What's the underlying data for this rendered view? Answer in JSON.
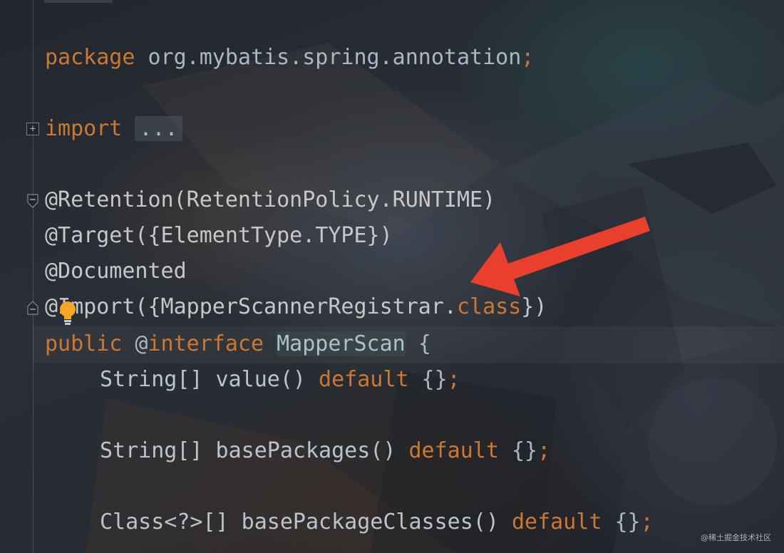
{
  "editor": {
    "lines": {
      "package": {
        "kw": "package",
        "rest": " org.mybatis.spring.annotation",
        "semi": ";"
      },
      "import": {
        "kw": "import",
        "folded": "..."
      },
      "retention": {
        "text": "@Retention(RetentionPolicy.RUNTIME)"
      },
      "target": {
        "text": "@Target({ElementType.TYPE})"
      },
      "documented": {
        "text": "@Documented"
      },
      "importAnn": {
        "start": "@Import({MapperScannerRegistrar.",
        "kw": "class",
        "end": "})"
      },
      "decl": {
        "kw1": "public",
        "at": " @",
        "kw2": "interface",
        "space": " ",
        "name": "MapperScan",
        "end": " {"
      },
      "value": {
        "type": "String[] value() ",
        "kw": "default",
        "end": " {}",
        "semi": ";"
      },
      "basePackages": {
        "type": "String[] basePackages() ",
        "kw": "default",
        "end": " {}",
        "semi": ";"
      },
      "basePackageClasses": {
        "type": "Class<?>[] basePackageClasses() ",
        "kw": "default",
        "end": " {}",
        "semi": ";"
      }
    }
  },
  "watermark": "@稀土掘金技术社区",
  "colors": {
    "keyword": "#cc7832",
    "annotation": "#c5c7c9",
    "text": "#a9b7c6",
    "arrow": "#e8402c"
  },
  "icons": [
    "fold-expand-icon",
    "fold-collapse-icon",
    "lightbulb-icon",
    "red-arrow-annotation"
  ]
}
